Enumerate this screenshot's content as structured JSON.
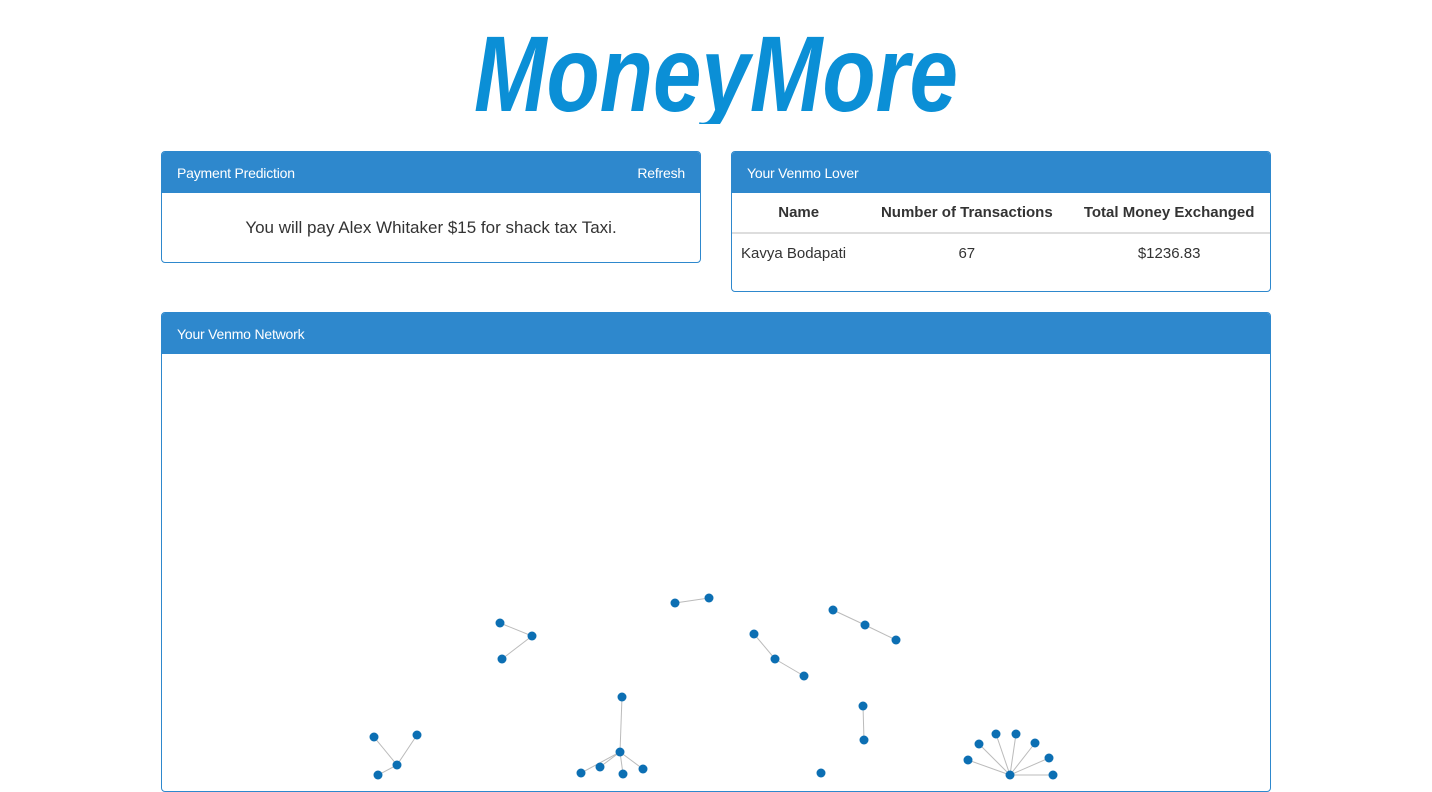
{
  "app": {
    "logo_text": "MoneyMore",
    "brand_color": "#0b8fd6",
    "accent_color": "#2e88cd"
  },
  "prediction_panel": {
    "title": "Payment Prediction",
    "refresh_label": "Refresh",
    "message": "You will pay Alex Whitaker $15 for shack tax Taxi."
  },
  "lover_panel": {
    "title": "Your Venmo Lover",
    "columns": [
      "Name",
      "Number of Transactions",
      "Total Money Exchanged"
    ],
    "rows": [
      [
        "Kavya Bodapati",
        "67",
        "$1236.83"
      ]
    ]
  },
  "network_panel": {
    "title": "Your Venmo Network",
    "node_color": "#0c6fb3",
    "edge_color": "#bbbbbb"
  }
}
